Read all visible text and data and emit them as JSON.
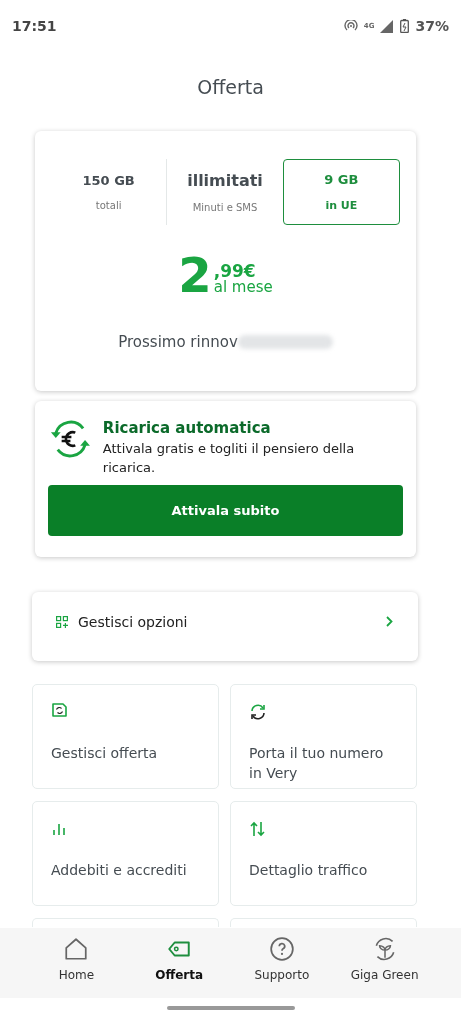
{
  "status_bar": {
    "time": "17:51",
    "battery": "37%",
    "network": "4G"
  },
  "header": {
    "title": "Offerta"
  },
  "plan": {
    "allowances": [
      {
        "amount": "150 GB",
        "caption": "totali",
        "selected": false
      },
      {
        "amount": "illimitati",
        "caption": "Minuti e SMS",
        "selected": false
      },
      {
        "amount": "9 GB",
        "caption": "in UE",
        "selected": true
      }
    ],
    "price_integer": "2",
    "price_decimal": ",99€",
    "price_period": "al mese",
    "renewal": "Prossimo rinnov"
  },
  "auto_topup": {
    "title": "Ricarica automatica",
    "text": "Attivala gratis e togliti il pensiero della ricarica.",
    "button": "Attivala subito"
  },
  "options_row": {
    "label": "Gestisci opzioni"
  },
  "tiles": [
    {
      "kind": "sim",
      "label": "Gestisci offerta"
    },
    {
      "kind": "refresh",
      "label": "Porta il tuo numero in Very"
    },
    {
      "kind": "bars",
      "label": "Addebiti e accrediti"
    },
    {
      "kind": "arrows",
      "label": "Dettaglio traffico"
    }
  ],
  "bottom_nav": [
    {
      "kind": "home",
      "label": "Home",
      "selected": false
    },
    {
      "kind": "tag",
      "label": "Offerta",
      "selected": true
    },
    {
      "kind": "help",
      "label": "Supporto",
      "selected": false
    },
    {
      "kind": "plant",
      "label": "Giga Green",
      "selected": false
    }
  ]
}
